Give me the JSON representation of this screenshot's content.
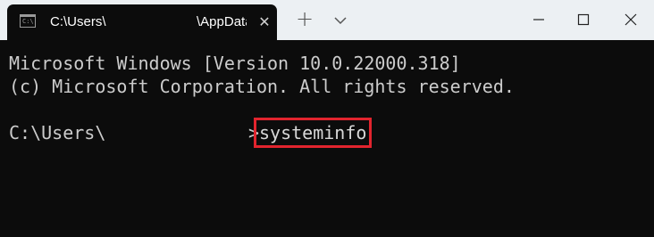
{
  "window": {
    "tab": {
      "title_part1": "C:\\Users\\",
      "title_part2": "\\AppData",
      "icon": "terminal-icon",
      "close_glyph": "✕"
    },
    "new_tab_glyph": "+",
    "controls": [
      "minimize-icon",
      "maximize-icon",
      "close-icon"
    ]
  },
  "terminal": {
    "lines": [
      "Microsoft Windows [Version 10.0.22000.318]",
      "(c) Microsoft Corporation. All rights reserved."
    ],
    "prompt_path": "C:\\Users\\",
    "prompt_symbol": ">",
    "command": "systeminfo"
  },
  "colors": {
    "background": "#0c0c0c",
    "titlebar": "#ecf0f3",
    "text": "#cccccc",
    "highlight": "#e2242e"
  }
}
